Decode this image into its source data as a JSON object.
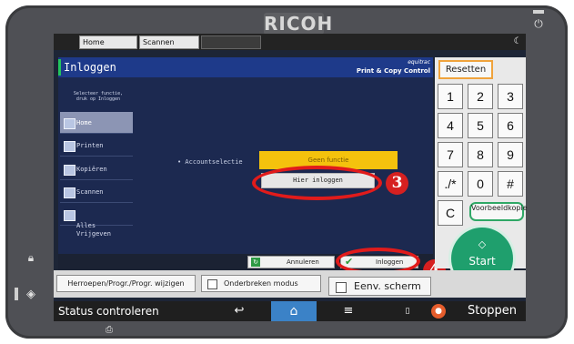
{
  "device": {
    "brand": "RICOH"
  },
  "topbar": {
    "tab_home": "Home",
    "tab_scan": "Scannen"
  },
  "app": {
    "title": "Inloggen",
    "logo_top": "equitrac",
    "logo_bottom": "Print & Copy Control",
    "instruction": "Selecteer functie,\ndruk op Inloggen",
    "menu": [
      {
        "label": "Home"
      },
      {
        "label": "Printen"
      },
      {
        "label": "Kopiëren"
      },
      {
        "label": "Scannen"
      },
      {
        "label": "Alles\nVrijgeven"
      }
    ],
    "account_label": "• Accountselectie",
    "yellow_button": "Geen functie",
    "login_here": "Hier inloggen",
    "cancel": "Annuleren",
    "login": "Inloggen"
  },
  "annotations": {
    "step3": "3",
    "step4": "4",
    "color": "#e11b1b"
  },
  "keypad": {
    "reset": "Resetten",
    "keys": [
      "1",
      "2",
      "3",
      "4",
      "5",
      "6",
      "7",
      "8",
      "9",
      "./*",
      "0",
      "#",
      "C"
    ],
    "preview": "Voorbeeldkopie",
    "start": "Start"
  },
  "bottom_buttons": {
    "recall": "Herroepen/Progr./Progr. wijzigen",
    "interrupt": "Onderbreken modus",
    "env": "Eenv. scherm"
  },
  "statusbar": {
    "status": "Status controleren",
    "stop": "Stoppen"
  },
  "icons": {
    "back": "back-arrow-icon",
    "home": "home-icon",
    "menu": "menu-icon",
    "storage": "storage-icon",
    "stop": "stop-icon",
    "power": "power-icon",
    "lock": "lock-icon",
    "energy": "energy-saver-icon"
  }
}
